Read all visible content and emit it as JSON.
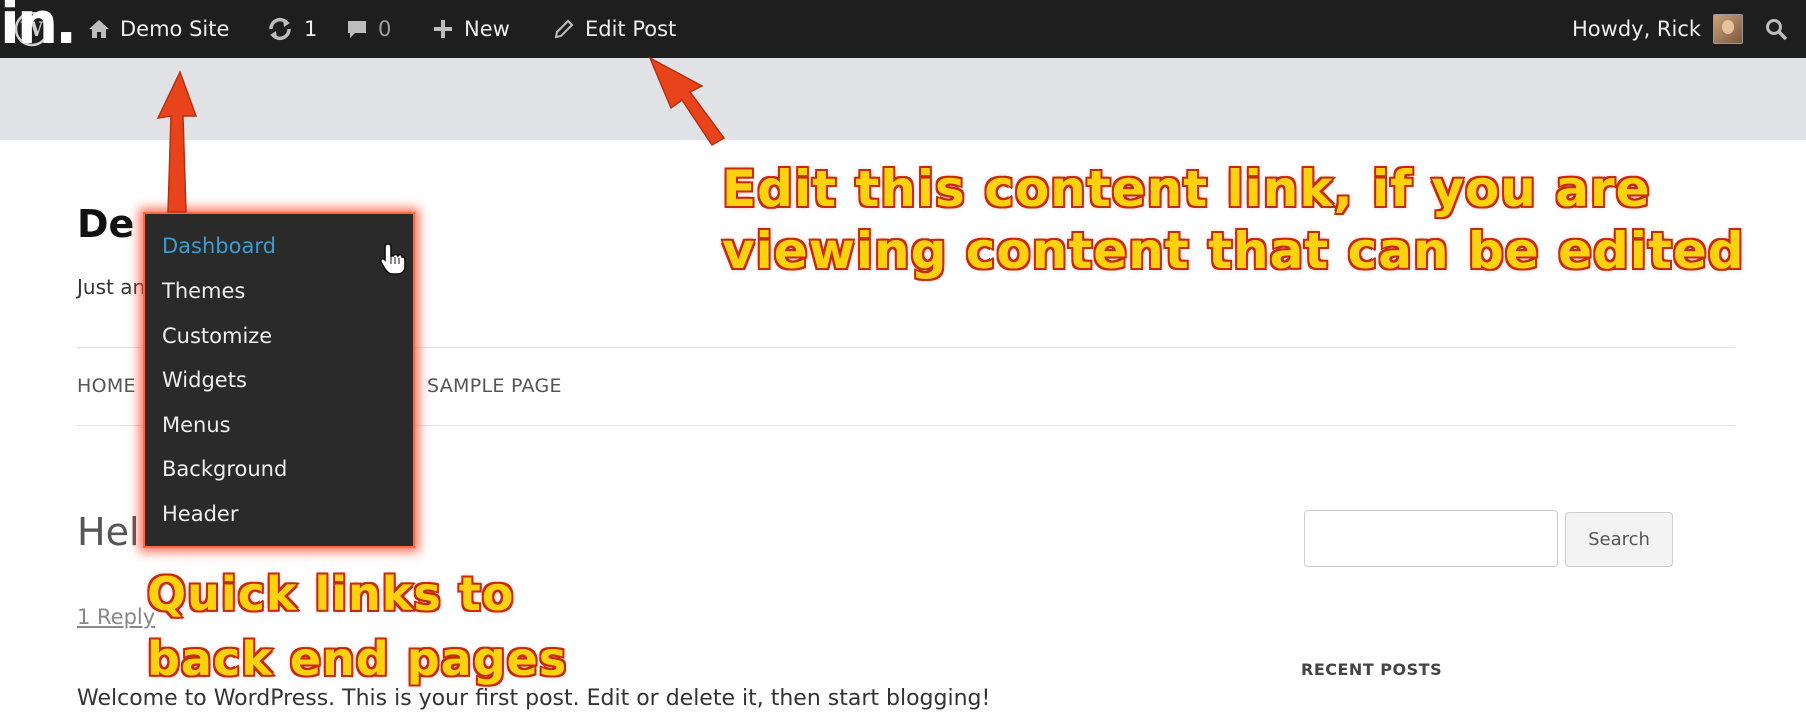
{
  "watermark": "in.",
  "adminbar": {
    "site_name": "Demo Site",
    "updates_count": "1",
    "comments_count": "0",
    "new_label": "New",
    "edit_post_label": "Edit Post",
    "howdy": "Howdy, Rick",
    "icons": [
      "wordpress-logo-icon",
      "home-icon",
      "updates-icon",
      "comment-icon",
      "plus-icon",
      "pencil-icon",
      "avatar",
      "search-icon"
    ]
  },
  "site": {
    "title": "Demo Site",
    "title_visible": "De",
    "tagline_visible": "Just an",
    "nav_left": "HOME",
    "nav_right": "SAMPLE PAGE"
  },
  "post": {
    "title_visible": "Hell",
    "reply_link": "1 Reply",
    "body": "Welcome to WordPress. This is your first post. Edit or delete it, then start blogging!"
  },
  "sidebar": {
    "search_placeholder": "",
    "search_button": "Search",
    "recent_posts_heading": "RECENT POSTS"
  },
  "dropdown": {
    "items": [
      {
        "label": "Dashboard",
        "active": true
      },
      {
        "label": "Themes",
        "active": false
      },
      {
        "label": "Customize",
        "active": false
      },
      {
        "label": "Widgets",
        "active": false
      },
      {
        "label": "Menus",
        "active": false
      },
      {
        "label": "Background",
        "active": false
      },
      {
        "label": "Header",
        "active": false
      }
    ]
  },
  "annotations": {
    "edit_line1": "Edit this content link, if you are",
    "edit_line2": "viewing content that can be edited",
    "quick_line1": "Quick links to",
    "quick_line2": "back end pages",
    "callout_fill": "#ffd20f",
    "callout_stroke": "#c62a0b",
    "arrow_color": "#e8431a"
  },
  "colors": {
    "adminbar_bg": "#1e1e1e",
    "band_bg": "#e0e2e5",
    "dropdown_bg": "#2a2a2a",
    "dropdown_glow": "#ff6a3d",
    "active_link": "#3a9dd1"
  }
}
